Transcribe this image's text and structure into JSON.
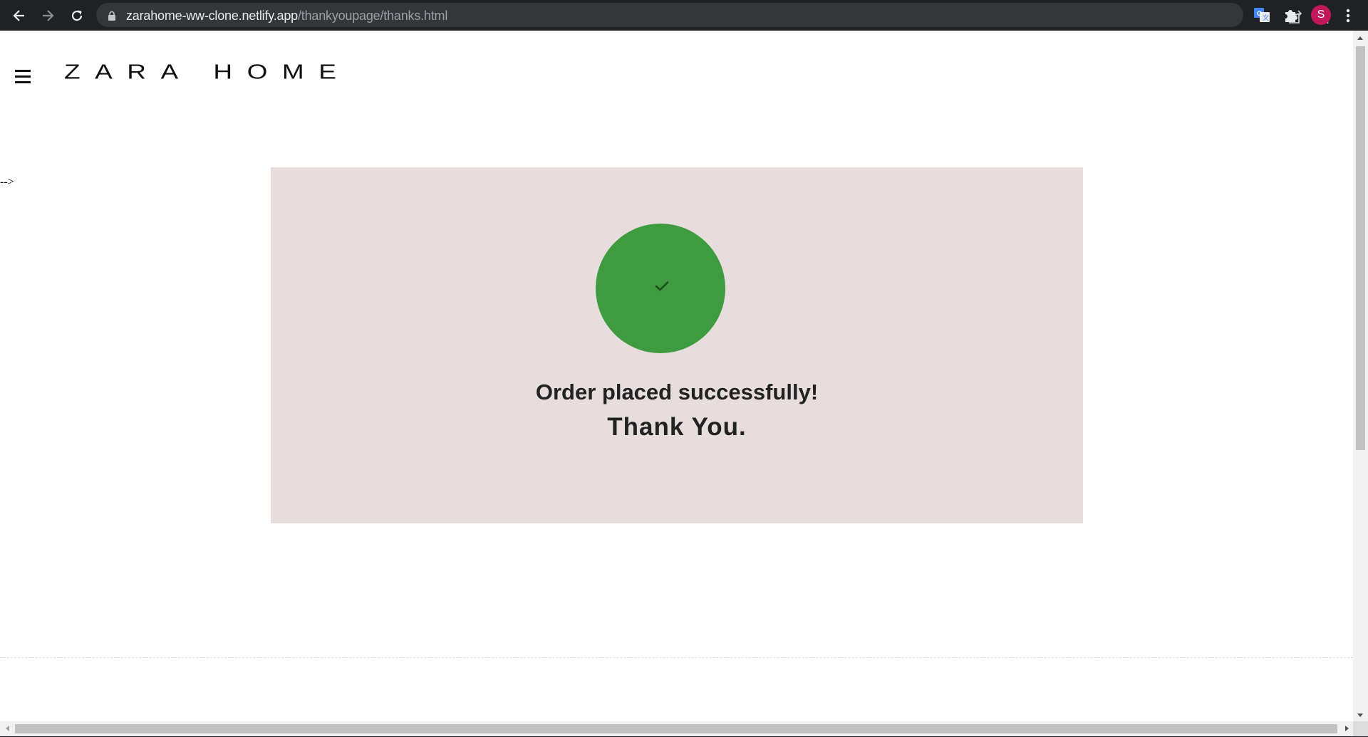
{
  "browser": {
    "url_host": "zarahome-ww-clone.netlify.app",
    "url_path": "/thankyoupage/thanks.html",
    "profile_initial": "S",
    "icons": [
      "back-arrow-icon",
      "forward-arrow-icon",
      "reload-icon",
      "lock-icon",
      "share-icon",
      "star-icon",
      "translate-icon",
      "puzzle-icon",
      "more-vert-icon"
    ]
  },
  "header": {
    "brand": "ZARA HOME",
    "menu_icon": "hamburger-icon"
  },
  "page": {
    "stray_text": "-->",
    "success_icon": "check-icon",
    "order_message": "Order placed successfully!",
    "thank_message": "Thank You."
  },
  "colors": {
    "card_background": "#e8dddd",
    "success_circle": "#3f9b3f",
    "check_mark": "#1e4d1e",
    "text": "#222222"
  }
}
